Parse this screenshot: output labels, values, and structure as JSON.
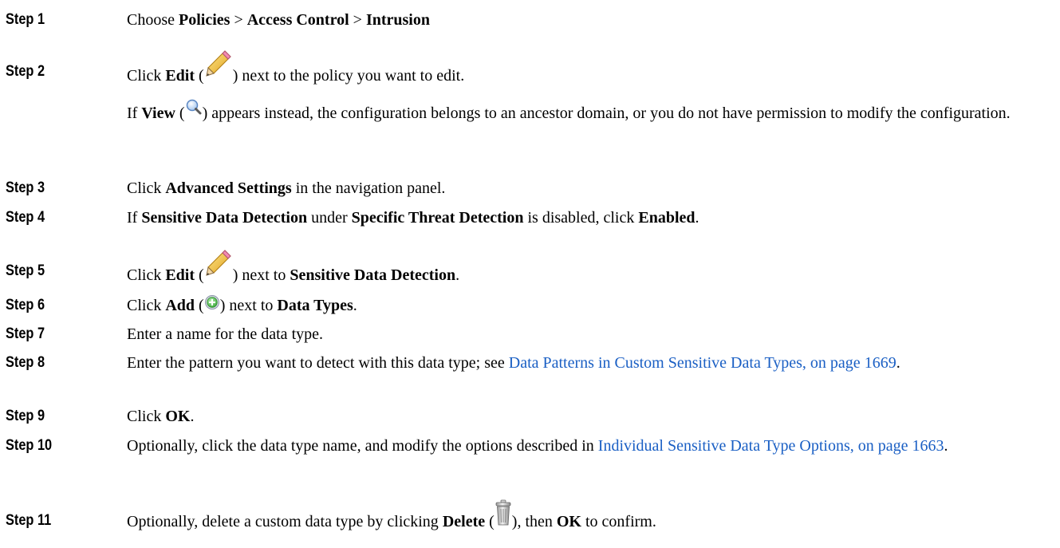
{
  "steps": [
    {
      "label": "Step 1",
      "pre": "Choose ",
      "b1": "Policies",
      "sep1": " > ",
      "b2": "Access Control",
      "sep2": " > ",
      "b3": "Intrusion"
    },
    {
      "label": "Step 2",
      "pre": "Click ",
      "b1": "Edit",
      "open": " (",
      "icon": "pencil-icon",
      "post": ") next to the policy you want to edit."
    },
    {
      "label": "Step 3",
      "pre": "Click ",
      "b1": "Advanced Settings",
      "post": " in the navigation panel."
    },
    {
      "label": "Step 4",
      "pre": "If ",
      "b1": "Sensitive Data Detection",
      "mid1": " under ",
      "b2": "Specific Threat Detection",
      "mid2": " is disabled, click ",
      "b3": "Enabled",
      "post": "."
    },
    {
      "label": "Step 5",
      "pre": "Click ",
      "b1": "Edit",
      "open": " (",
      "icon": "pencil-icon",
      "mid": ") next to ",
      "b2": "Sensitive Data Detection",
      "post": "."
    },
    {
      "label": "Step 6",
      "pre": "Click ",
      "b1": "Add",
      "open": " (",
      "icon": "add-circle-icon",
      "mid": ") next to ",
      "b2": "Data Types",
      "post": "."
    },
    {
      "label": "Step 7",
      "text": "Enter a name for the data type."
    },
    {
      "label": "Step 8",
      "pre": "Enter the pattern you want to detect with this data type; see ",
      "link": "Data Patterns in Custom Sensitive Data Types, on page 1669",
      "post": "."
    },
    {
      "label": "Step 9",
      "pre": "Click ",
      "b1": "OK",
      "post": "."
    },
    {
      "label": "Step 10",
      "pre": "Optionally, click the data type name, and modify the options described in ",
      "link": "Individual Sensitive Data Type Options, on page 1663",
      "post": "."
    },
    {
      "label": "Step 11",
      "pre": "Optionally, delete a custom data type by clicking ",
      "b1": "Delete",
      "open": " (",
      "icon": "trash-icon",
      "mid": "), then ",
      "b2": "OK",
      "post": " to confirm."
    }
  ],
  "note_step2": {
    "pre": "If ",
    "b1": "View",
    "open": " (",
    "icon": "magnifier-icon",
    "post": ") appears instead, the configuration belongs to an ancestor domain, or you do not have permission to modify the configuration."
  }
}
